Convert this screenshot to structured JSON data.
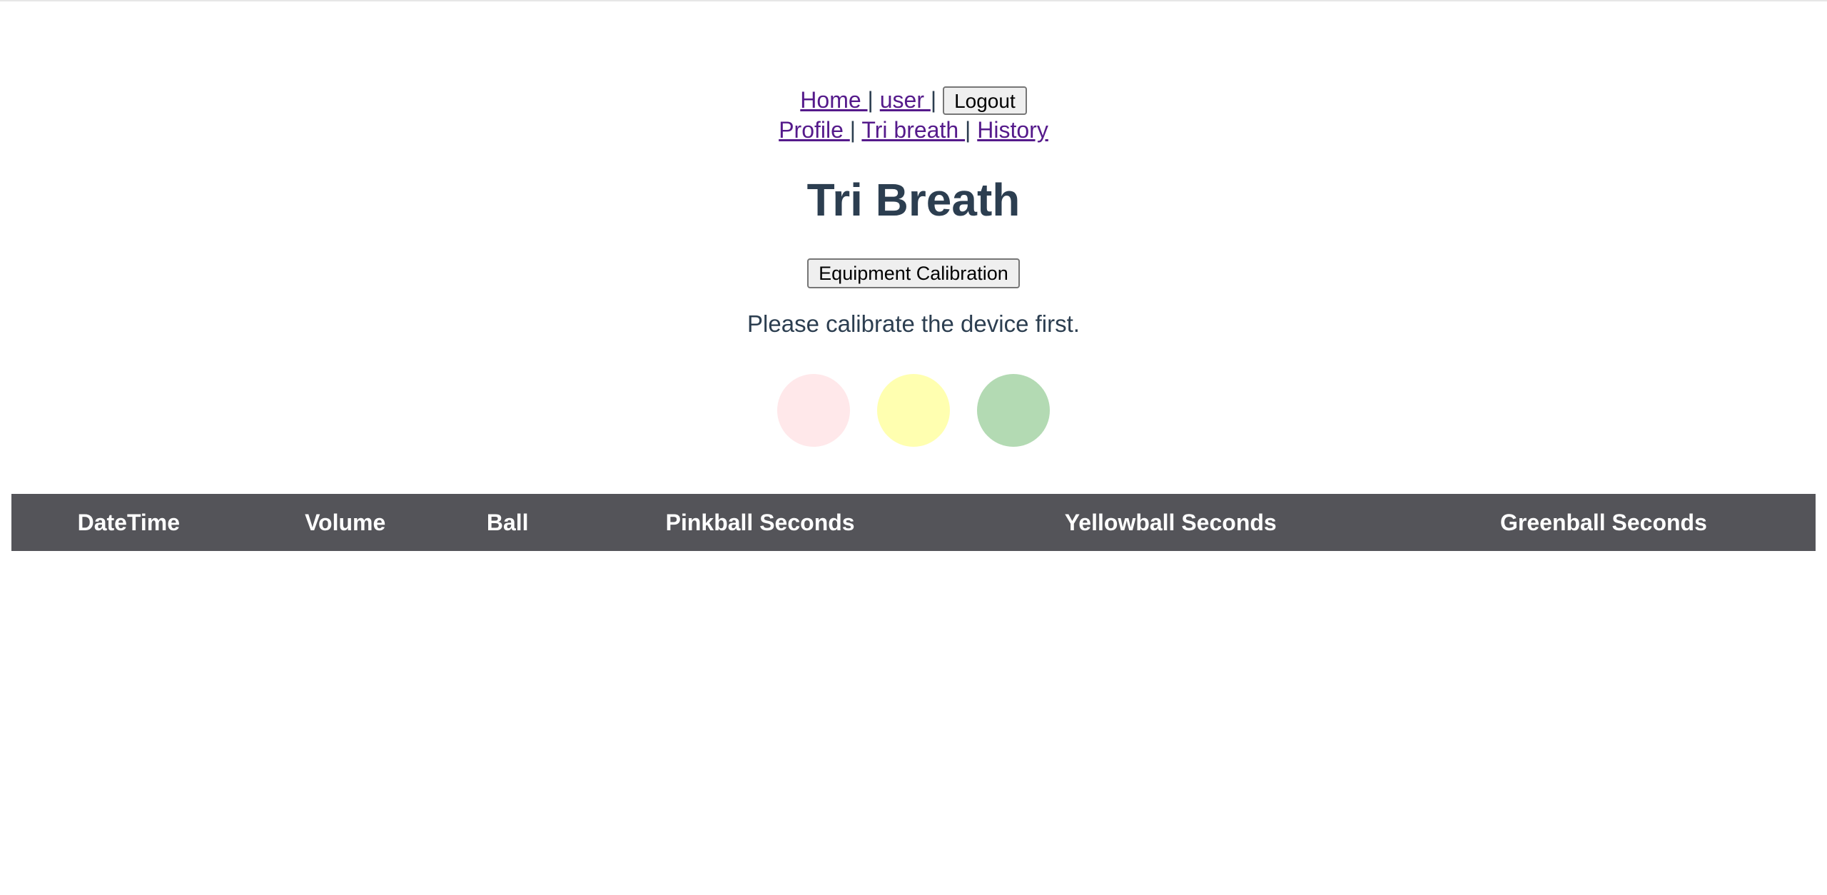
{
  "nav": {
    "home": "Home ",
    "user": "user ",
    "separator": "|",
    "logout": "Logout",
    "profile": "Profile ",
    "tri_breath": "Tri breath ",
    "history": "History"
  },
  "page_title": "Tri Breath",
  "calibration_button": "Equipment Calibration",
  "status_message": "Please calibrate the device first.",
  "balls": {
    "pink_color": "#ffe8ea",
    "yellow_color": "#ffffb0",
    "green_color": "#b3dab3"
  },
  "table": {
    "header_bg": "#545459",
    "columns": [
      "DateTime",
      "Volume",
      "Ball",
      "Pinkball Seconds",
      "Yellowball Seconds",
      "Greenball Seconds"
    ],
    "rows": []
  }
}
